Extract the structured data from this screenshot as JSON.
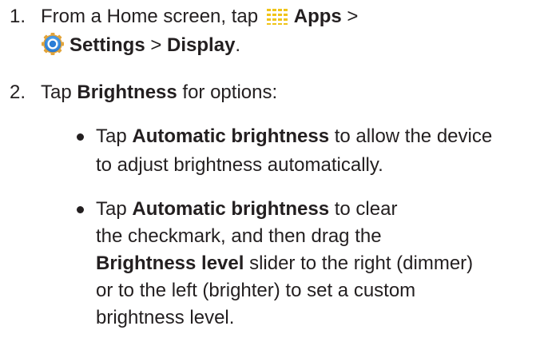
{
  "step1": {
    "number": "1.",
    "line1_prefix": "From a Home screen, tap ",
    "apps_label": "Apps",
    "line1_suffix": " >",
    "apps_icon": "apps-grid-icon",
    "settings_icon": "settings-gear-icon",
    "settings_label": "Settings",
    "separator": " > ",
    "display_label": "Display",
    "period": "."
  },
  "step2": {
    "number": "2.",
    "tap_prefix": "Tap ",
    "brightness_label": "Brightness",
    "tap_suffix": " for options:"
  },
  "bullet1": {
    "tap_prefix": "Tap ",
    "auto_label": "Automatic brightness",
    "line1_suffix": " to allow the device",
    "line2": "to adjust brightness automatically."
  },
  "bullet2": {
    "tap_prefix": "Tap ",
    "auto_label": "Automatic brightness",
    "line1_suffix": " to clear",
    "line2": "the checkmark, and then drag the",
    "level_label": "Brightness level",
    "line3_suffix": " slider to the right (dimmer)",
    "line4": "or to the left (brighter) to set a custom",
    "line5": "brightness level."
  },
  "colors": {
    "text": "#231f20",
    "icon_blue": "#1f7fd6",
    "icon_grid": "#f0c419"
  }
}
